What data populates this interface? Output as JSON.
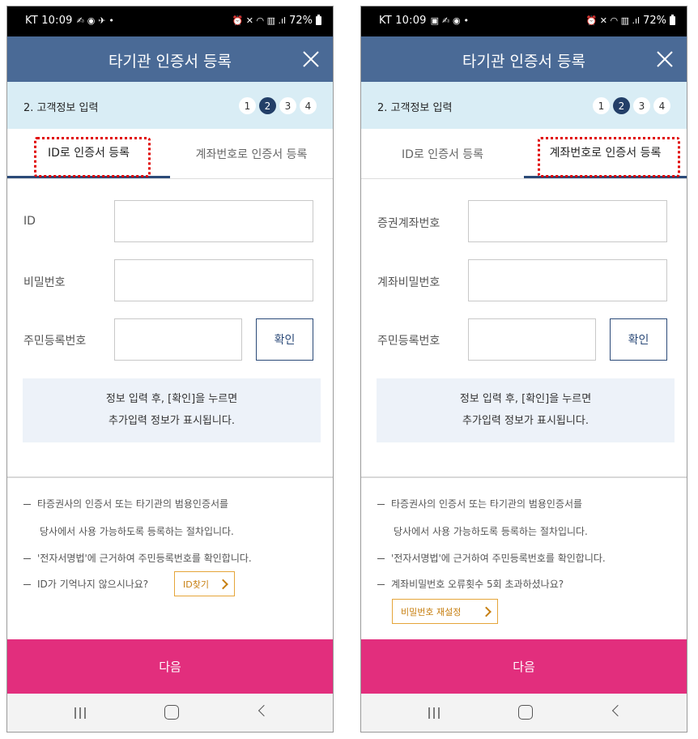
{
  "colors": {
    "status_bar": "#000000",
    "title_bar": "#4a6a96",
    "step_bar": "#d9edf5",
    "step_active": "#233f68",
    "tab_underline": "#2b4a78",
    "highlight_dotted": "#e00000",
    "info_box": "#edf2f9",
    "inline_button_border": "#e5a53a",
    "next_button": "#e22e7d",
    "nav_bar": "#f3f3f3"
  },
  "left": {
    "status": {
      "time": "KT 10:09",
      "icons_left": "✍ ◉ ✈ •",
      "icons_right": "⏰ ✕ ◠ ▥ .ıl",
      "battery": "72%"
    },
    "title": "타기관 인증서 등록",
    "close_icon": "close-icon",
    "step_label": "2. 고객정보 입력",
    "steps": [
      "1",
      "2",
      "3",
      "4"
    ],
    "active_step": "2",
    "tabs": [
      "ID로 인증서 등록",
      "계좌번호로 인증서 등록"
    ],
    "active_tab": 0,
    "fields": {
      "f1": "ID",
      "f2": "비밀번호",
      "f3": "주민등록번호"
    },
    "confirm": "확인",
    "info": [
      "정보 입력 후, [확인]을 누르면",
      "추가입력 정보가 표시됩니다."
    ],
    "notes": {
      "n1": "타증권사의 인증서 또는 타기관의 범용인증서를",
      "n2": "당사에서 사용 가능하도록 등록하는 절차입니다.",
      "n3": "'전자서명법'에 근거하여 주민등록번호를 확인합니다.",
      "n4": "ID가 기억나지 않으시나요?"
    },
    "extra_button": "ID찾기",
    "next": "다음"
  },
  "right": {
    "status": {
      "time": "KT 10:09",
      "icons_left": "▣ ✍ ◉ •",
      "icons_right": "⏰ ✕ ◠ ▥ .ıl",
      "battery": "72%"
    },
    "title": "타기관 인증서 등록",
    "close_icon": "close-icon",
    "step_label": "2. 고객정보 입력",
    "steps": [
      "1",
      "2",
      "3",
      "4"
    ],
    "active_step": "2",
    "tabs": [
      "ID로 인증서 등록",
      "계좌번호로 인증서 등록"
    ],
    "active_tab": 1,
    "fields": {
      "f1": "증권계좌번호",
      "f2": "계좌비밀번호",
      "f3": "주민등록번호"
    },
    "confirm": "확인",
    "info": [
      "정보 입력 후, [확인]을 누르면",
      "추가입력 정보가 표시됩니다."
    ],
    "notes": {
      "n1": "타증권사의 인증서 또는 타기관의 범용인증서를",
      "n2": "당사에서 사용 가능하도록 등록하는 절차입니다.",
      "n3": "'전자서명법'에 근거하여 주민등록번호를 확인합니다.",
      "n4": "계좌비밀번호 오류횟수 5회 초과하셨나요?"
    },
    "extra_button": "비밀번호 재설정",
    "next": "다음"
  }
}
